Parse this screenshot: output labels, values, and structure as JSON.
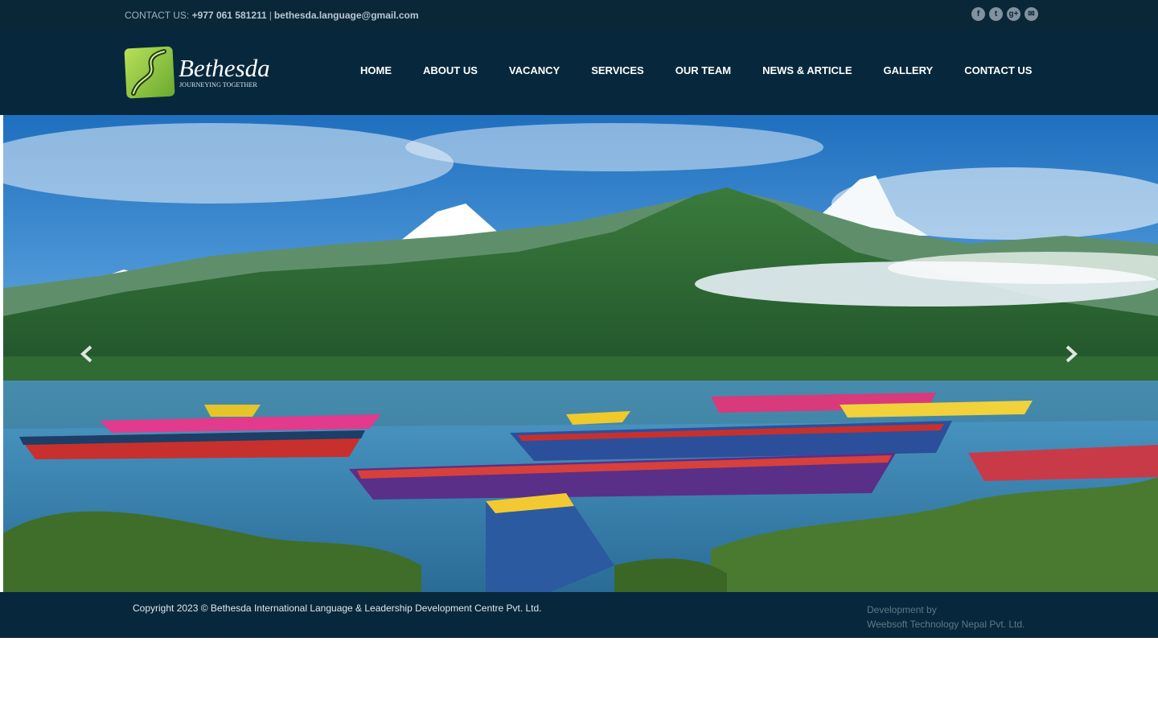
{
  "topbar": {
    "contact_label": "CONTACT US:",
    "phone": "+977 061 581211",
    "separator": "|",
    "email": "bethesda.language@gmail.com",
    "social_icons": [
      "facebook-icon",
      "twitter-icon",
      "google-plus-icon",
      "email-icon"
    ]
  },
  "logo": {
    "name": "Bethesda",
    "tagline": "JOURNEYING TOGETHER"
  },
  "nav": {
    "items": [
      {
        "label": "HOME"
      },
      {
        "label": "ABOUT US"
      },
      {
        "label": "VACANCY"
      },
      {
        "label": "SERVICES"
      },
      {
        "label": "OUR TEAM"
      },
      {
        "label": "NEWS & ARTICLE"
      },
      {
        "label": "GALLERY"
      },
      {
        "label": "CONTACT US"
      }
    ]
  },
  "hero": {
    "prev_icon": "chevron-left-icon",
    "next_icon": "chevron-right-icon"
  },
  "footer": {
    "copyright": "Copyright 2023 © Bethesda International Language & Leadership Development Centre Pvt. Ltd.",
    "dev_line1": "Development by",
    "dev_line2": "Weebsoft Technology Nepal Pvt. Ltd."
  },
  "colors": {
    "topbar_bg": "#0a2738",
    "header_bg": "#07283c",
    "logo_green": "#8cc63f",
    "nav_text": "#ffffff"
  }
}
